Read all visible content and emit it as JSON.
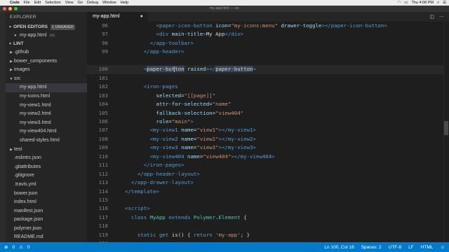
{
  "menubar": {
    "apple": "",
    "items": [
      "Code",
      "File",
      "Edit",
      "Selection",
      "View",
      "Go",
      "Debug",
      "Window",
      "Help"
    ],
    "clock": "Thu 4:08 PM"
  },
  "window": {
    "title": "my-app.html — src"
  },
  "sidebar": {
    "header": "EXPLORER",
    "open_editors": {
      "title": "OPEN EDITORS",
      "badge": "1 UNSAVED",
      "file": "my-app.html",
      "dir": "src"
    },
    "project": {
      "title": "LINT",
      "items": [
        {
          "label": ".github",
          "folder": true,
          "expanded": false,
          "depth": 1
        },
        {
          "label": "bower_components",
          "folder": true,
          "expanded": false,
          "depth": 1
        },
        {
          "label": "images",
          "folder": true,
          "expanded": false,
          "depth": 1
        },
        {
          "label": "src",
          "folder": true,
          "expanded": true,
          "depth": 1
        },
        {
          "label": "my-app.html",
          "folder": false,
          "depth": 2,
          "active": true
        },
        {
          "label": "my-icons.html",
          "folder": false,
          "depth": 2
        },
        {
          "label": "my-view1.html",
          "folder": false,
          "depth": 2
        },
        {
          "label": "my-view2.html",
          "folder": false,
          "depth": 2
        },
        {
          "label": "my-view3.html",
          "folder": false,
          "depth": 2
        },
        {
          "label": "my-view404.html",
          "folder": false,
          "depth": 2
        },
        {
          "label": "shared-styles.html",
          "folder": false,
          "depth": 2
        },
        {
          "label": "test",
          "folder": true,
          "expanded": false,
          "depth": 1
        },
        {
          "label": ".eslintrc.json",
          "folder": false,
          "depth": 1
        },
        {
          "label": ".gitattributes",
          "folder": false,
          "depth": 1
        },
        {
          "label": ".gitignore",
          "folder": false,
          "depth": 1
        },
        {
          "label": ".travis.yml",
          "folder": false,
          "depth": 1
        },
        {
          "label": "bower.json",
          "folder": false,
          "depth": 1
        },
        {
          "label": "index.html",
          "folder": false,
          "depth": 1
        },
        {
          "label": "manifest.json",
          "folder": false,
          "depth": 1
        },
        {
          "label": "package.json",
          "folder": false,
          "depth": 1
        },
        {
          "label": "polymer.json",
          "folder": false,
          "depth": 1
        },
        {
          "label": "README.md",
          "folder": false,
          "depth": 1
        }
      ]
    }
  },
  "tabs": [
    {
      "label": "my-app.html"
    }
  ],
  "editor": {
    "current_line": 100,
    "lines": [
      {
        "n": "96",
        "tokens": [
          [
            "pl",
            "          "
          ],
          [
            "tag",
            "<paper-icon-button"
          ],
          [
            "pl",
            " "
          ],
          [
            "attr",
            "icon"
          ],
          [
            "pl",
            "="
          ],
          [
            "str",
            "\"my-icons:menu\""
          ],
          [
            "pl",
            " "
          ],
          [
            "attr",
            "drawer-toggle"
          ],
          [
            "tag",
            "></paper-icon-button>"
          ]
        ]
      },
      {
        "n": "97",
        "tokens": [
          [
            "pl",
            "          "
          ],
          [
            "tag",
            "<div"
          ],
          [
            "pl",
            " "
          ],
          [
            "attr",
            "main-title"
          ],
          [
            "tag",
            ">"
          ],
          [
            "pl",
            "My App"
          ],
          [
            "tag",
            "</div>"
          ]
        ]
      },
      {
        "n": "98",
        "tokens": [
          [
            "pl",
            "        "
          ],
          [
            "tag",
            "</app-toolbar>"
          ]
        ]
      },
      {
        "n": "99",
        "tokens": [
          [
            "pl",
            "      "
          ],
          [
            "tag",
            "</app-header>"
          ]
        ]
      },
      {
        "n": "",
        "tokens": []
      },
      {
        "n": "100",
        "tokens": [
          [
            "pl",
            "      "
          ],
          [
            "tag",
            "<"
          ],
          [
            "hl",
            "paper-button"
          ],
          [
            "pl",
            " "
          ],
          [
            "attr",
            "raised"
          ],
          [
            "tag",
            "></"
          ],
          [
            "hl",
            "paper-button"
          ],
          [
            "tag",
            ">"
          ]
        ]
      },
      {
        "n": "101",
        "tokens": []
      },
      {
        "n": "102",
        "tokens": [
          [
            "pl",
            "      "
          ],
          [
            "tag",
            "<iron-pages"
          ]
        ]
      },
      {
        "n": "103",
        "tokens": [
          [
            "pl",
            "          "
          ],
          [
            "attr",
            "selected"
          ],
          [
            "pl",
            "="
          ],
          [
            "str",
            "\"[[page]]\""
          ]
        ]
      },
      {
        "n": "104",
        "tokens": [
          [
            "pl",
            "          "
          ],
          [
            "attr",
            "attr-for-selected"
          ],
          [
            "pl",
            "="
          ],
          [
            "str",
            "\"name\""
          ]
        ]
      },
      {
        "n": "105",
        "tokens": [
          [
            "pl",
            "          "
          ],
          [
            "attr",
            "fallback-selection"
          ],
          [
            "pl",
            "="
          ],
          [
            "str",
            "\"view404\""
          ]
        ]
      },
      {
        "n": "106",
        "tokens": [
          [
            "pl",
            "          "
          ],
          [
            "attr",
            "role"
          ],
          [
            "pl",
            "="
          ],
          [
            "str",
            "\"main\""
          ],
          [
            "tag",
            ">"
          ]
        ]
      },
      {
        "n": "107",
        "tokens": [
          [
            "pl",
            "        "
          ],
          [
            "tag",
            "<my-view1"
          ],
          [
            "pl",
            " "
          ],
          [
            "attr",
            "name"
          ],
          [
            "pl",
            "="
          ],
          [
            "str",
            "\"view1\""
          ],
          [
            "tag",
            "></my-view1>"
          ]
        ]
      },
      {
        "n": "108",
        "tokens": [
          [
            "pl",
            "        "
          ],
          [
            "tag",
            "<my-view2"
          ],
          [
            "pl",
            " "
          ],
          [
            "attr",
            "name"
          ],
          [
            "pl",
            "="
          ],
          [
            "str",
            "\"view2\""
          ],
          [
            "tag",
            "></my-view2>"
          ]
        ]
      },
      {
        "n": "109",
        "tokens": [
          [
            "pl",
            "        "
          ],
          [
            "tag",
            "<my-view3"
          ],
          [
            "pl",
            " "
          ],
          [
            "attr",
            "name"
          ],
          [
            "pl",
            "="
          ],
          [
            "str",
            "\"view3\""
          ],
          [
            "tag",
            "></my-view3>"
          ]
        ]
      },
      {
        "n": "110",
        "tokens": [
          [
            "pl",
            "        "
          ],
          [
            "tag",
            "<my-view404"
          ],
          [
            "pl",
            " "
          ],
          [
            "attr",
            "name"
          ],
          [
            "pl",
            "="
          ],
          [
            "str",
            "\"view404\""
          ],
          [
            "tag",
            "></my-view404>"
          ]
        ]
      },
      {
        "n": "111",
        "tokens": [
          [
            "pl",
            "      "
          ],
          [
            "tag",
            "</iron-pages>"
          ]
        ]
      },
      {
        "n": "112",
        "tokens": [
          [
            "pl",
            "    "
          ],
          [
            "tag",
            "</app-header-layout>"
          ]
        ]
      },
      {
        "n": "113",
        "tokens": [
          [
            "pl",
            "  "
          ],
          [
            "tag",
            "</app-drawer-layout>"
          ]
        ]
      },
      {
        "n": "114",
        "tokens": [
          [
            "tag",
            "</template>"
          ]
        ]
      },
      {
        "n": "115",
        "tokens": []
      },
      {
        "n": "116",
        "tokens": [
          [
            "tag",
            "<script>"
          ]
        ]
      },
      {
        "n": "117",
        "tokens": [
          [
            "pl",
            "  "
          ],
          [
            "kw",
            "class"
          ],
          [
            "pl",
            " "
          ],
          [
            "cls",
            "MyApp"
          ],
          [
            "pl",
            " "
          ],
          [
            "kw",
            "extends"
          ],
          [
            "pl",
            " "
          ],
          [
            "cls",
            "Polymer"
          ],
          [
            "pl",
            "."
          ],
          [
            "cls",
            "Element"
          ],
          [
            "pl",
            " {"
          ]
        ]
      },
      {
        "n": "118",
        "tokens": []
      },
      {
        "n": "119",
        "tokens": [
          [
            "pl",
            "    "
          ],
          [
            "kw",
            "static"
          ],
          [
            "pl",
            " "
          ],
          [
            "kw",
            "get"
          ],
          [
            "pl",
            " "
          ],
          [
            "fn",
            "is"
          ],
          [
            "pl",
            "() { "
          ],
          [
            "kw",
            "return"
          ],
          [
            "pl",
            " "
          ],
          [
            "str",
            "'my-app'"
          ],
          [
            "pl",
            "; }"
          ]
        ]
      },
      {
        "n": "120",
        "tokens": []
      }
    ]
  },
  "statusbar": {
    "errors": "0",
    "warnings": "0",
    "position": "Ln 100, Col 18",
    "indent": "Spaces: 2",
    "encoding": "UTF-8",
    "eol": "LF",
    "language": "HTML",
    "feedback_icon": "smiley-icon"
  },
  "colors": {
    "statusbar": "#007acc",
    "editor_bg": "#1e1e1e",
    "sidebar_bg": "#252526",
    "tag": "#569cd6",
    "attr": "#9cdcfe",
    "string": "#ce9178"
  }
}
